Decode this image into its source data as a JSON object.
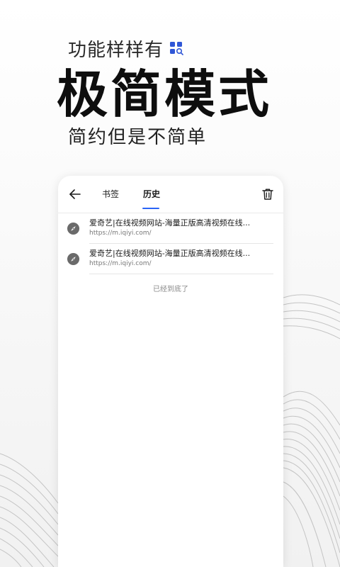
{
  "hero": {
    "tagline": "功能样样有",
    "title": "极简模式",
    "subtitle": "简约但是不简单",
    "icon": "grid-search-icon"
  },
  "browser": {
    "tabs": [
      {
        "label": "书签",
        "active": false
      },
      {
        "label": "历史",
        "active": true
      }
    ],
    "icons": {
      "back": "arrow-left-icon",
      "delete": "trash-icon",
      "entry": "compass-icon"
    },
    "history": [
      {
        "title": "爱奇艺|在线视频网站-海量正版高清视频在线...",
        "url": "https://m.iqiyi.com/"
      },
      {
        "title": "爱奇艺|在线视频网站-海量正版高清视频在线...",
        "url": "https://m.iqiyi.com/"
      }
    ],
    "end_text": "已经到底了"
  },
  "colors": {
    "accent": "#2a64f6",
    "brand_icon": "#2f56d6",
    "text": "#1a1a1a",
    "muted": "#777777"
  }
}
